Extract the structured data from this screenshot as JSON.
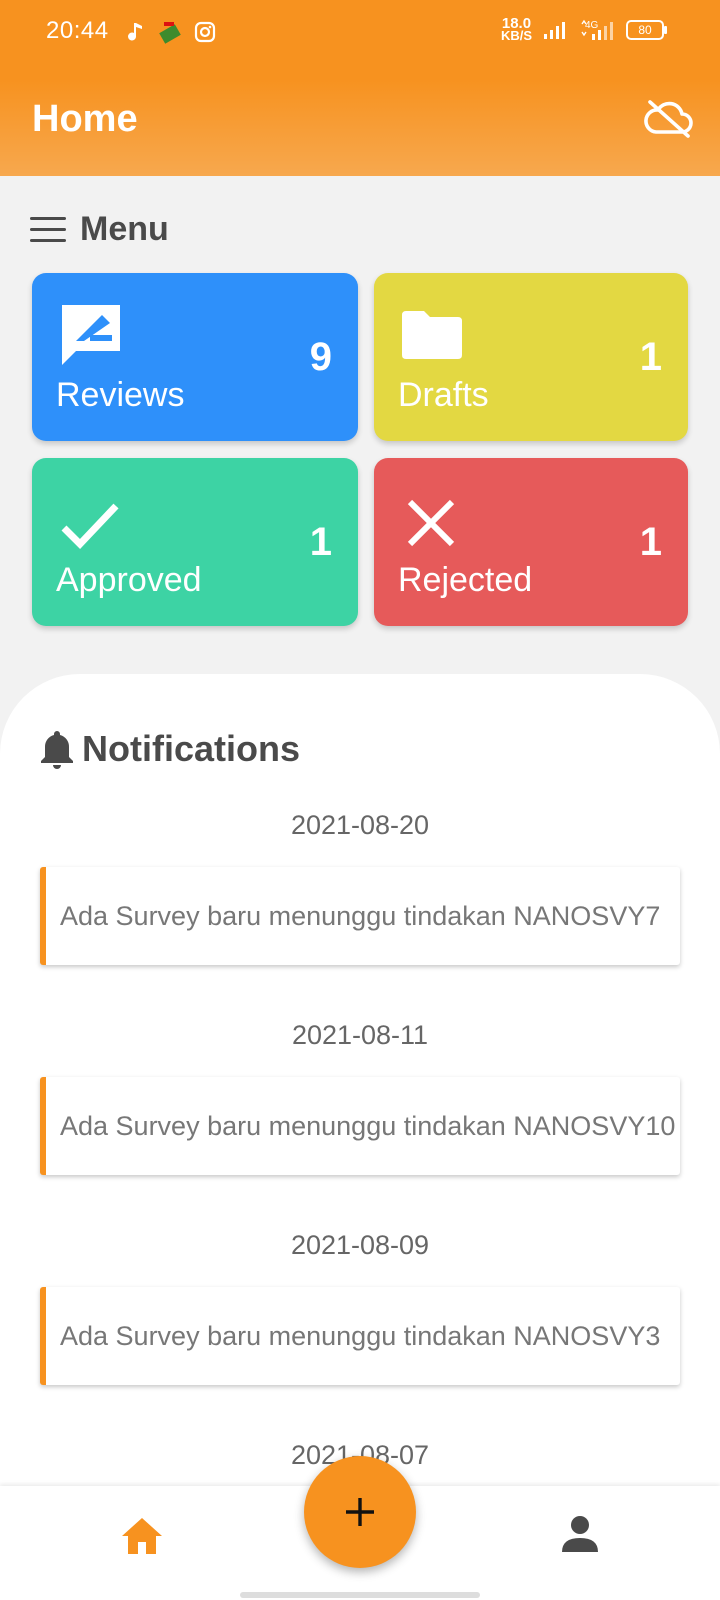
{
  "status_bar": {
    "time": "20:44",
    "net_speed_value": "18.0",
    "net_speed_unit": "KB/S",
    "battery": "80",
    "icons": [
      "music-note-icon",
      "app-icon",
      "instagram-icon",
      "signal-icon",
      "4g-signal-icon",
      "battery-icon"
    ]
  },
  "app_bar": {
    "title": "Home",
    "action_icon": "cloud-off-icon"
  },
  "menu": {
    "title": "Menu",
    "tiles": [
      {
        "label": "Reviews",
        "count": "9",
        "icon": "rate-review-icon",
        "color": "#2e90fa"
      },
      {
        "label": "Drafts",
        "count": "1",
        "icon": "folder-icon",
        "color": "#e3d842"
      },
      {
        "label": "Approved",
        "count": "1",
        "icon": "check-icon",
        "color": "#3dd3a4"
      },
      {
        "label": "Rejected",
        "count": "1",
        "icon": "close-icon",
        "color": "#e65a5a"
      }
    ]
  },
  "notifications": {
    "title": "Notifications",
    "groups": [
      {
        "date": "2021-08-20",
        "message": "Ada Survey baru menunggu tindakan NANOSVY7"
      },
      {
        "date": "2021-08-11",
        "message": "Ada Survey baru menunggu tindakan NANOSVY10"
      },
      {
        "date": "2021-08-09",
        "message": "Ada Survey baru menunggu tindakan NANOSVY3"
      },
      {
        "date": "2021-08-07",
        "message": ""
      }
    ]
  },
  "bottom_nav": {
    "items": [
      {
        "name": "home",
        "icon": "home-icon",
        "active": true
      },
      {
        "name": "profile",
        "icon": "person-icon",
        "active": false
      }
    ],
    "fab_icon": "plus-icon"
  },
  "colors": {
    "accent": "#f7921f",
    "reviews": "#2e90fa",
    "drafts": "#e3d842",
    "approved": "#3dd3a4",
    "rejected": "#e65a5a"
  }
}
